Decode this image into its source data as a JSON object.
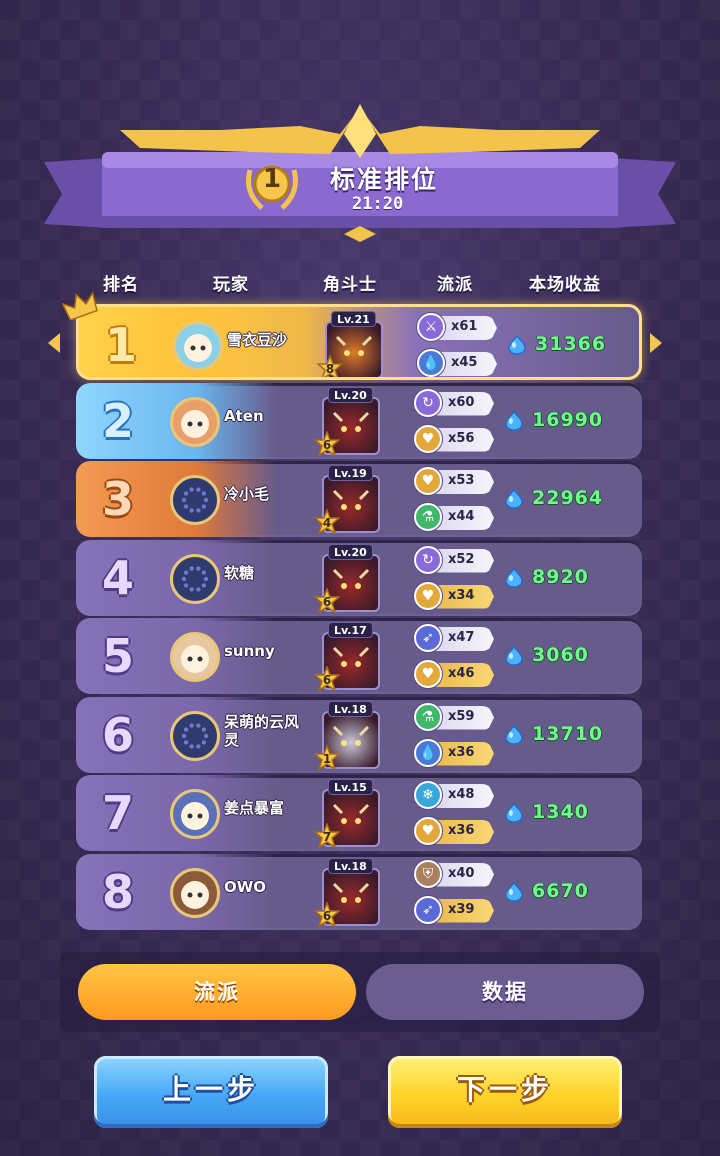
{
  "header": {
    "rank_badge": "1",
    "title": "标准排位",
    "time": "21:20"
  },
  "columns": {
    "rank": "排名",
    "player": "玩家",
    "fighter": "角斗士",
    "school": "流派",
    "earnings": "本场收益"
  },
  "rows": [
    {
      "rank": "1",
      "name": "雪衣豆沙",
      "level": "Lv.21",
      "stars": "8",
      "schools": [
        {
          "icon": "sword-icon",
          "count": "x61",
          "color": "#8a6ad6"
        },
        {
          "icon": "water-drop-icon",
          "count": "x45",
          "color": "#4a7ad8"
        }
      ],
      "earnings": "31366"
    },
    {
      "rank": "2",
      "name": "Aten",
      "level": "Lv.20",
      "stars": "6",
      "schools": [
        {
          "icon": "cycle-icon",
          "count": "x60",
          "color": "#8a6ad6"
        },
        {
          "icon": "heart-icon",
          "count": "x56",
          "color": "#e2a83a"
        }
      ],
      "earnings": "16990"
    },
    {
      "rank": "3",
      "name": "冷小毛",
      "level": "Lv.19",
      "stars": "4",
      "schools": [
        {
          "icon": "heart-icon",
          "count": "x53",
          "color": "#e2a83a"
        },
        {
          "icon": "potion-icon",
          "count": "x44",
          "color": "#3fb86a"
        }
      ],
      "earnings": "22964"
    },
    {
      "rank": "4",
      "name": "软糖",
      "level": "Lv.20",
      "stars": "6",
      "schools": [
        {
          "icon": "cycle-icon",
          "count": "x52",
          "color": "#8a6ad6"
        },
        {
          "icon": "heart-icon",
          "count": "x34",
          "color": "#e2a83a"
        }
      ],
      "earnings": "8920"
    },
    {
      "rank": "5",
      "name": "sunny",
      "level": "Lv.17",
      "stars": "6",
      "schools": [
        {
          "icon": "boot-icon",
          "count": "x47",
          "color": "#5a6ad8"
        },
        {
          "icon": "heart-icon",
          "count": "x46",
          "color": "#e2a83a"
        }
      ],
      "earnings": "3060"
    },
    {
      "rank": "6",
      "name": "呆萌的云风灵",
      "level": "Lv.18",
      "stars": "1",
      "schools": [
        {
          "icon": "potion-icon",
          "count": "x59",
          "color": "#3fb86a"
        },
        {
          "icon": "water-drop-icon",
          "count": "x36",
          "color": "#4a7ad8"
        }
      ],
      "earnings": "13710"
    },
    {
      "rank": "7",
      "name": "姜点暴富",
      "level": "Lv.15",
      "stars": "7",
      "schools": [
        {
          "icon": "snowflake-icon",
          "count": "x48",
          "color": "#38a8d8"
        },
        {
          "icon": "heart-icon",
          "count": "x36",
          "color": "#e2a83a"
        }
      ],
      "earnings": "1340"
    },
    {
      "rank": "8",
      "name": "OWO",
      "level": "Lv.18",
      "stars": "6",
      "schools": [
        {
          "icon": "shield-icon",
          "count": "x40",
          "color": "#a88060"
        },
        {
          "icon": "boot-icon",
          "count": "x39",
          "color": "#5a6ad8"
        }
      ],
      "earnings": "6670"
    }
  ],
  "tabs": {
    "school": "流派",
    "data": "数据"
  },
  "buttons": {
    "prev": "上一步",
    "next": "下一步"
  },
  "colors": {
    "earnings_green": "#6dff8a",
    "gold": "#f6c64a",
    "row_purple": "#675b8b"
  }
}
